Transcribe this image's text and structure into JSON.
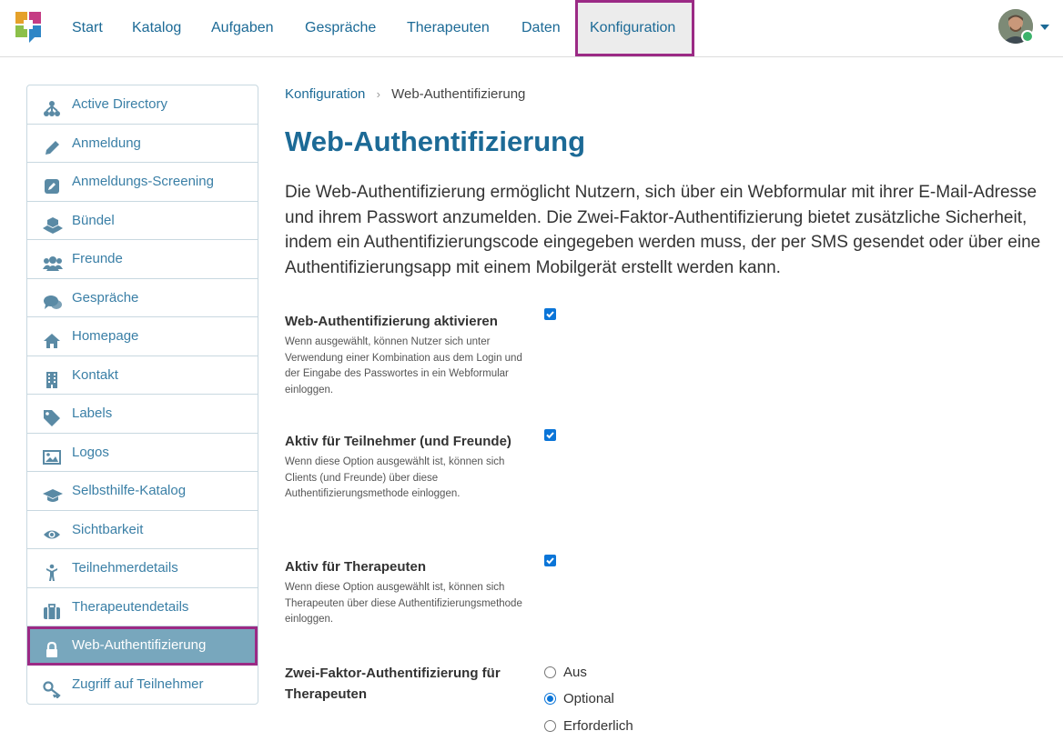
{
  "nav": {
    "items": [
      "Start",
      "Katalog",
      "Aufgaben",
      "Gespräche",
      "Therapeuten",
      "Daten",
      "Konfiguration"
    ],
    "active": "Konfiguration",
    "accent_color": "#1c6a96",
    "highlight_color": "#9b2a85"
  },
  "sidebar": {
    "items": [
      {
        "label": "Active Directory",
        "icon": "sitemap-icon"
      },
      {
        "label": "Anmeldung",
        "icon": "pencil-icon"
      },
      {
        "label": "Anmeldungs-Screening",
        "icon": "edit-square-icon"
      },
      {
        "label": "Bündel",
        "icon": "cubes-icon"
      },
      {
        "label": "Freunde",
        "icon": "users-icon"
      },
      {
        "label": "Gespräche",
        "icon": "comments-icon"
      },
      {
        "label": "Homepage",
        "icon": "home-icon"
      },
      {
        "label": "Kontakt",
        "icon": "building-icon"
      },
      {
        "label": "Labels",
        "icon": "tag-icon"
      },
      {
        "label": "Logos",
        "icon": "image-icon"
      },
      {
        "label": "Selbsthilfe-Katalog",
        "icon": "graduation-cap-icon"
      },
      {
        "label": "Sichtbarkeit",
        "icon": "eye-icon"
      },
      {
        "label": "Teilnehmerdetails",
        "icon": "child-icon"
      },
      {
        "label": "Therapeutendetails",
        "icon": "briefcase-icon"
      },
      {
        "label": "Web-Authentifizierung",
        "icon": "lock-icon"
      },
      {
        "label": "Zugriff auf Teilnehmer",
        "icon": "key-icon"
      }
    ],
    "active": "Web-Authentifizierung",
    "active_bg": "#78a7bd"
  },
  "breadcrumb": {
    "parent": "Konfiguration",
    "current": "Web-Authentifizierung"
  },
  "page": {
    "title": "Web-Authentifizierung",
    "intro": "Die Web-Authentifizierung ermöglicht Nutzern, sich über ein Webformular mit ihrer E-Mail-Adresse und ihrem Passwort anzumelden. Die Zwei-Faktor-Authentifizierung bietet zusätzliche Sicherheit, indem ein Authentifizierungscode eingegeben werden muss, der per SMS gesendet oder über eine Authentifizierungsapp mit einem Mobilgerät erstellt werden kann."
  },
  "settings": [
    {
      "label": "Web-Authentifizierung aktivieren",
      "help": "Wenn ausgewählt, können Nutzer sich unter Verwendung einer Kombination aus dem Login und der Eingabe des Passwortes in ein Webformular einloggen.",
      "checked": true
    },
    {
      "label": "Aktiv für Teilnehmer (und Freunde)",
      "help": "Wenn diese Option ausgewählt ist, können sich Clients (und Freunde) über diese Authentifizierungsmethode einloggen.",
      "checked": true
    },
    {
      "label": "Aktiv für Therapeuten",
      "help": "Wenn diese Option ausgewählt ist, können sich Therapeuten über diese Authentifizierungsmethode einloggen.",
      "checked": true
    }
  ],
  "two_factor": {
    "label": "Zwei-Faktor-Authentifizierung für Therapeuten",
    "options": [
      "Aus",
      "Optional",
      "Erforderlich"
    ],
    "selected": "Optional"
  }
}
